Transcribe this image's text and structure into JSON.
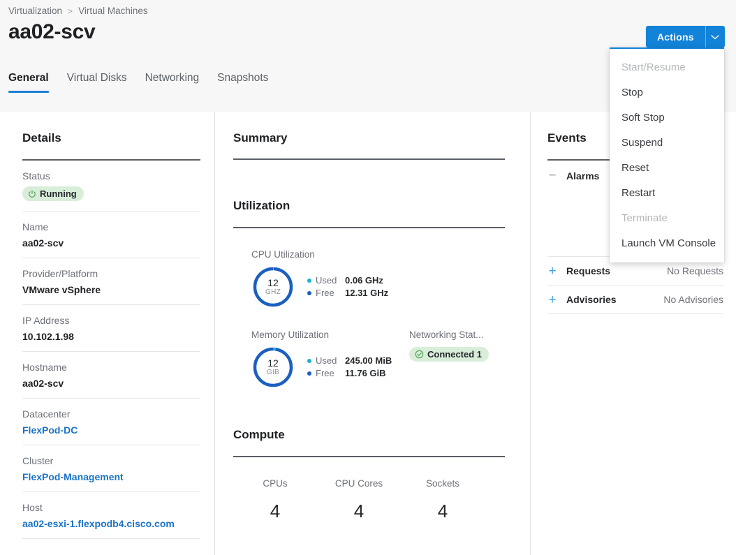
{
  "breadcrumb": {
    "root": "Virtualization",
    "separator": ">",
    "current": "Virtual Machines"
  },
  "page_title": "aa02-scv",
  "tabs": [
    {
      "label": "General",
      "active": true
    },
    {
      "label": "Virtual Disks",
      "active": false
    },
    {
      "label": "Networking",
      "active": false
    },
    {
      "label": "Snapshots",
      "active": false
    }
  ],
  "actions": {
    "label": "Actions",
    "menu": [
      {
        "label": "Start/Resume",
        "disabled": true
      },
      {
        "label": "Stop",
        "disabled": false
      },
      {
        "label": "Soft Stop",
        "disabled": false
      },
      {
        "label": "Suspend",
        "disabled": false
      },
      {
        "label": "Reset",
        "disabled": false
      },
      {
        "label": "Restart",
        "disabled": false
      },
      {
        "label": "Terminate",
        "disabled": true
      },
      {
        "label": "Launch VM Console",
        "disabled": false
      }
    ]
  },
  "details": {
    "title": "Details",
    "status_label": "Status",
    "status_value": "Running",
    "rows": [
      {
        "label": "Name",
        "value": "aa02-scv",
        "link": false
      },
      {
        "label": "Provider/Platform",
        "value": "VMware vSphere",
        "link": false
      },
      {
        "label": "IP Address",
        "value": "10.102.1.98",
        "link": false
      },
      {
        "label": "Hostname",
        "value": "aa02-scv",
        "link": false
      },
      {
        "label": "Datacenter",
        "value": "FlexPod-DC",
        "link": true
      },
      {
        "label": "Cluster",
        "value": "FlexPod-Management",
        "link": true
      },
      {
        "label": "Host",
        "value": "aa02-esxi-1.flexpodb4.cisco.com",
        "link": true
      }
    ]
  },
  "summary": {
    "title": "Summary",
    "utilization_title": "Utilization",
    "compute_title": "Compute",
    "cpu": {
      "label": "CPU Utilization",
      "total": "12",
      "unit": "GHZ",
      "used_key": "Used",
      "used_value": "0.06 GHz",
      "free_key": "Free",
      "free_value": "12.31 GHz"
    },
    "memory": {
      "label": "Memory Utilization",
      "total": "12",
      "unit": "GIB",
      "used_key": "Used",
      "used_value": "245.00 MiB",
      "free_key": "Free",
      "free_value": "11.76 GiB"
    },
    "networking": {
      "label": "Networking Stat...",
      "badge": "Connected 1"
    },
    "compute": [
      {
        "label": "CPUs",
        "value": "4"
      },
      {
        "label": "CPU Cores",
        "value": "4"
      },
      {
        "label": "Sockets",
        "value": "4"
      }
    ]
  },
  "events": {
    "title": "Events",
    "rows": [
      {
        "name": "Alarms",
        "status": "",
        "toggle": "minus"
      },
      {
        "name": "Requests",
        "status": "No Requests",
        "toggle": "plus"
      },
      {
        "name": "Advisories",
        "status": "No Advisories",
        "toggle": "plus"
      }
    ]
  },
  "chart_data": [
    {
      "type": "pie",
      "title": "CPU Utilization",
      "categories": [
        "Used",
        "Free"
      ],
      "values": [
        0.06,
        12.31
      ],
      "unit": "GHz",
      "center_label": "12 GHZ",
      "colors": [
        "#16b3d4",
        "#1b5fc1"
      ],
      "legend": "right"
    },
    {
      "type": "pie",
      "title": "Memory Utilization",
      "categories": [
        "Used",
        "Free"
      ],
      "values": [
        0.2393,
        11.76
      ],
      "unit": "GiB",
      "center_label": "12 GIB",
      "colors": [
        "#16b3d4",
        "#1b5fc1"
      ],
      "legend": "right"
    }
  ],
  "colors": {
    "accent": "#1283d8",
    "link": "#1a73c7",
    "used": "#16b3d4",
    "free": "#1b5fc1",
    "badge_bg": "#d9eed9",
    "badge_fg": "#3f8f46"
  }
}
